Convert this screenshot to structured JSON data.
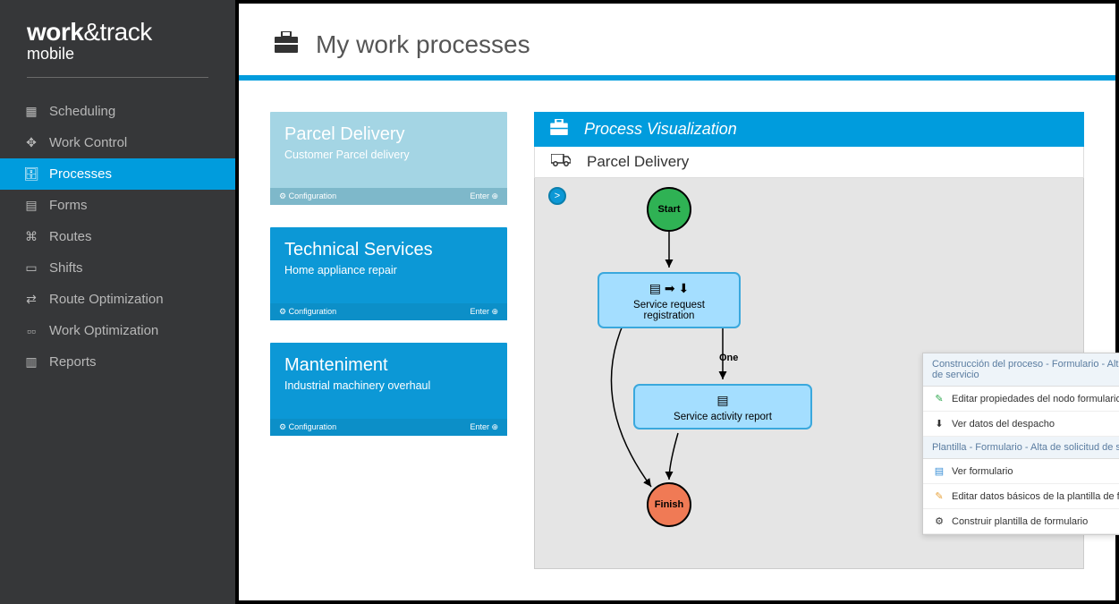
{
  "brand": {
    "line1_a": "work",
    "line1_b": "&track",
    "line2": "mobile"
  },
  "nav": {
    "items": [
      {
        "label": "Scheduling",
        "icon": "▦"
      },
      {
        "label": "Work Control",
        "icon": "✥"
      },
      {
        "label": "Processes",
        "icon": "🗄"
      },
      {
        "label": "Forms",
        "icon": "▤"
      },
      {
        "label": "Routes",
        "icon": "⌘"
      },
      {
        "label": "Shifts",
        "icon": "▭"
      },
      {
        "label": "Route Optimization",
        "icon": "⇄"
      },
      {
        "label": "Work Optimization",
        "icon": "▫▫"
      },
      {
        "label": "Reports",
        "icon": "▥"
      }
    ],
    "active_index": 2
  },
  "header": {
    "icon": "briefcase",
    "title": "My work processes"
  },
  "cards": [
    {
      "title": "Parcel Delivery",
      "subtitle": "Customer Parcel delivery",
      "config": "Configuration",
      "enter": "Enter",
      "selected": true
    },
    {
      "title": "Technical Services",
      "subtitle": "Home appliance repair",
      "config": "Configuration",
      "enter": "Enter",
      "selected": false
    },
    {
      "title": "Manteniment",
      "subtitle": "Industrial machinery overhaul",
      "config": "Configuration",
      "enter": "Enter",
      "selected": false
    }
  ],
  "viz": {
    "header": "Process Visualization",
    "subtitle": "Parcel Delivery",
    "toggle": ">",
    "nodes": {
      "start": "Start",
      "finish": "Finish",
      "srq": "Service request registration",
      "sar": "Service activity report"
    },
    "edge_label": "One"
  },
  "context_menu": {
    "section1_title": "Construcción del proceso - Formulario - Alta de solicitud de servicio",
    "section1_items": [
      {
        "icon": "✎",
        "icon_class": "green",
        "label": "Editar propiedades del nodo formulario"
      },
      {
        "icon": "⬇",
        "icon_class": "dark",
        "label": "Ver datos del despacho"
      }
    ],
    "section2_title": "Plantilla - Formulario - Alta de solicitud de servicio",
    "section2_items": [
      {
        "icon": "▤",
        "icon_class": "blue",
        "label": "Ver formulario"
      },
      {
        "icon": "✎",
        "icon_class": "orange",
        "label": "Editar datos básicos de la plantilla de formulario"
      },
      {
        "icon": "⚙",
        "icon_class": "dark",
        "label": "Construir plantilla de formulario"
      }
    ]
  },
  "colors": {
    "accent": "#009cdd",
    "sidebar": "#363739"
  }
}
